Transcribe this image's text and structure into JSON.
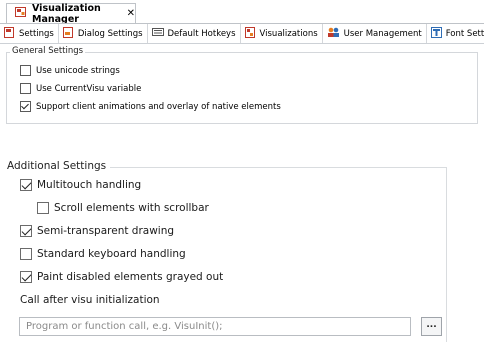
{
  "document_tab": {
    "title": "Visualization Manager",
    "close_glyph": "✕",
    "icon": "visu-manager-icon"
  },
  "subtabs": [
    {
      "label": "Settings",
      "icon": "settings-doc-icon",
      "active": true
    },
    {
      "label": "Dialog Settings",
      "icon": "dialog-icon",
      "active": false
    },
    {
      "label": "Default Hotkeys",
      "icon": "keyboard-icon",
      "active": false
    },
    {
      "label": "Visualizations",
      "icon": "visu-icon",
      "active": false
    },
    {
      "label": "User Management",
      "icon": "users-icon",
      "active": false
    },
    {
      "label": "Font Setting",
      "icon": "font-icon",
      "active": false
    }
  ],
  "general_settings": {
    "legend": "General Settings",
    "options": [
      {
        "label": "Use unicode strings",
        "checked": false
      },
      {
        "label": "Use CurrentVisu variable",
        "checked": false
      },
      {
        "label": "Support client animations and overlay of native elements",
        "checked": true
      }
    ]
  },
  "additional_settings": {
    "legend": "Additional Settings",
    "options": [
      {
        "label": "Multitouch handling",
        "checked": true
      },
      {
        "label": "Scroll elements with scrollbar",
        "checked": false
      },
      {
        "label": "Semi-transparent drawing",
        "checked": true
      },
      {
        "label": "Standard keyboard handling",
        "checked": false
      },
      {
        "label": "Paint disabled elements grayed out",
        "checked": true
      }
    ],
    "call_after_label": "Call after visu initialization",
    "call_after_value": "",
    "call_after_placeholder": "Program or function call, e.g. VisuInit();",
    "browse_label": "..."
  },
  "colors": {
    "border": "#d4d7db",
    "accent_red": "#c0392b",
    "accent_blue": "#2f6db5"
  }
}
